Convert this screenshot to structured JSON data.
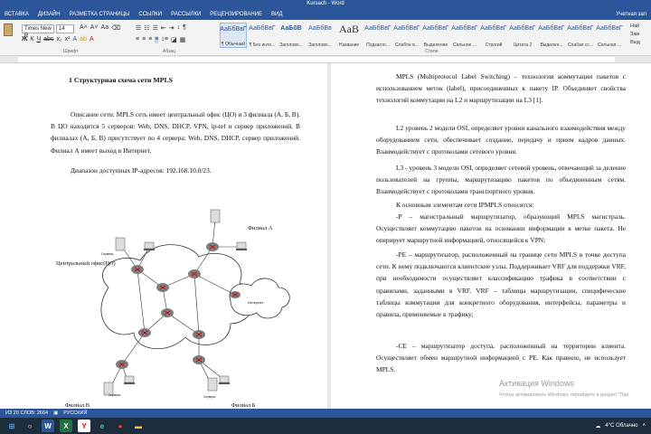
{
  "window": {
    "title": "Kursach - Word"
  },
  "menu": {
    "tabs": [
      "ВСТАВКА",
      "ДИЗАЙН",
      "РАЗМЕТКА СТРАНИЦЫ",
      "ССЫЛКИ",
      "РАССЫЛКИ",
      "РЕЦЕНЗИРОВАНИЕ",
      "ВИД"
    ],
    "account": "Учетная зап"
  },
  "ribbon": {
    "font_name": "Times New R",
    "font_size": "14",
    "group_labels": {
      "font": "Шрифт",
      "paragraph": "Абзац",
      "styles": "Стили"
    },
    "styles": [
      {
        "preview": "АаБбВвГ",
        "label": "¶ Обычный",
        "active": true
      },
      {
        "preview": "АаБбВвГ",
        "label": "¶ Без инте...",
        "active": false
      },
      {
        "preview": "АаБбВ",
        "label": "Заголово...",
        "active": false
      },
      {
        "preview": "АаБбВв",
        "label": "Заголово...",
        "active": false
      },
      {
        "preview": "AaB",
        "label": "Название",
        "active": false
      },
      {
        "preview": "АаБбВвГ",
        "label": "Подзагол...",
        "active": false
      },
      {
        "preview": "АаБбВвГ",
        "label": "Слабое в...",
        "active": false
      },
      {
        "preview": "АаБбВвГ",
        "label": "Выделение",
        "active": false
      },
      {
        "preview": "АаБбВвГ",
        "label": "Сильное ...",
        "active": false
      },
      {
        "preview": "АаБбВвГ",
        "label": "Строгий",
        "active": false
      },
      {
        "preview": "АаБбВвГ",
        "label": "Цитата 2",
        "active": false
      },
      {
        "preview": "АаБбВвГ",
        "label": "Выделен...",
        "active": false
      },
      {
        "preview": "АаБбВвГ",
        "label": "Слабая сс...",
        "active": false
      },
      {
        "preview": "АаБбВвГ",
        "label": "Сильная ...",
        "active": false
      }
    ],
    "right_panel": [
      "Най",
      "Зам",
      "Выд"
    ]
  },
  "left_page": {
    "heading": "1 Структурная схема сети MPLS",
    "para1": "Описание сети: MPLS сеть имеет центральный офис (ЦО) и 3 филиала (А, Б, В). В ЦО находится 5 серверов: Web, DNS, DHCP, VPN, ip-tel и сервер приложений. В филиалах (А, Б, В) присутствует по 4 сервера: Web, DNS, DHCP, сервер приложений. Филиал А имеет выход в Интернет.",
    "para2": "Диапазон доступных IP-адресов: 192.168.10.0/23.",
    "diagram": {
      "labels": {
        "co": "Центральный офис(ЦО)",
        "branch_a": "Филиал А",
        "branch_b": "Филиал Б",
        "branch_c": "Филиал В",
        "internet": "Интернет",
        "servers": "Серверы"
      }
    }
  },
  "right_page": {
    "p1": "MPLS (Multiprotocol Label Switching) – технология коммутации пакетов с использованием меток (label), присоединенных к пакету IP. Объединяет свойства технологий коммутации на L2 и маршрутизации на L3 [1].",
    "p2": "L2 уровень 2 модели OSI, определяет уровни канального взаимодействия между оборудованием сети, обеспечивает создание, передачу и прием кадров данных. Взаимодействует с протоколами сетевого уровня.",
    "p3": "L3 - уровень 3 модели OSI, определяет сетевой уровень, отвечающий за деление пользователей на группы, маршрутизацию пакетов по объединенным сетям. Взаимодействует с протоколами транспортного уровня.",
    "p4": "К основным элементам сети IPMPLS относятся:",
    "p5": "-P – магистральный маршрутизатор, образующий MPLS магистраль. Осуществляет коммутацию пакетов на основании информации в метке пакета. Не оперирует маршрутной информацией, относящейся к VPN;",
    "p6": "-PE – маршрутизатор, расположенный на границе сети MPLS в точке доступа сети. К нему подключаются клиентские узлы. Поддерживает VRF для поддержки VRF, при необходимости осуществляет классификацию трафика в соответствии с правилами, заданными в VRF. VRF – таблицы маршрутизации, специфические таблицы коммутации для конкретного оборудования, интерфейсы, параметры и правила, применяемые к трафику;",
    "p7": "-CE – маршрутизатор доступа, расположенный на территории клиента. Осуществляет обмен маршрутной информацией с PE. Как правило, не использует MPLS."
  },
  "watermark": {
    "line1": "Активация Windows",
    "line2": "Чтобы активировать Windows, перейдите в раздел \"Пар"
  },
  "status": {
    "words": "ИЗ 20 СЛОВ: 2664",
    "language": "РУССКИЙ"
  },
  "taskbar": {
    "weather": "4°C Облачно",
    "apps": [
      "start",
      "search",
      "word",
      "excel",
      "yandex",
      "edge",
      "chrome",
      "explorer"
    ]
  },
  "colors": {
    "accent": "#2b579a",
    "taskbar": "#1e2d3b",
    "router": "#7d7d7d"
  }
}
